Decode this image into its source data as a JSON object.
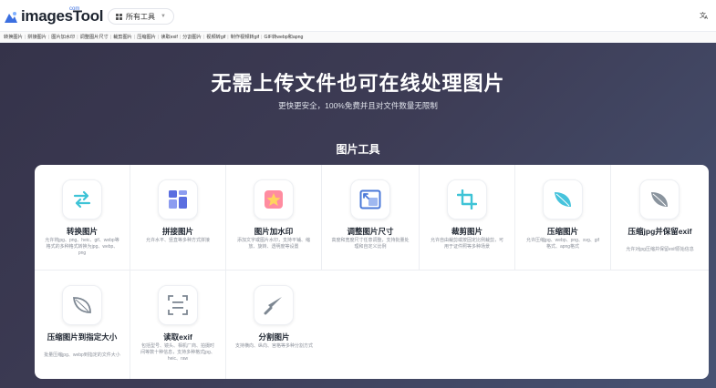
{
  "header": {
    "logo_text": "imagesTool",
    "logo_sup": "com",
    "all_tools_label": "所有工具",
    "lang_icon": "translate-icon"
  },
  "subnav": {
    "items": [
      "转换图片",
      "拼接图片",
      "图片加水印",
      "调整图片尺寸",
      "裁剪图片",
      "压缩图片",
      "读取exif",
      "分割图片",
      "视频转gif",
      "制作视频转gif",
      "GIF转webp和apng"
    ]
  },
  "hero": {
    "title": "无需上传文件也可在线处理图片",
    "subtitle": "更快更安全，100%免费并且对文件数量无限制",
    "section_title": "图片工具"
  },
  "tools": [
    {
      "name": "转换图片",
      "desc": "允许将jpg、png、heic、gif、webp等格式的多种格式转换为jpg、webp、png",
      "icon": "convert-arrows-icon"
    },
    {
      "name": "拼接图片",
      "desc": "允许水平、竖直等多种方式拼接",
      "icon": "collage-icon"
    },
    {
      "name": "图片加水印",
      "desc": "添加文字或图片水印，支持平铺、缩放、旋转、透明度等设置",
      "icon": "watermark-star-icon"
    },
    {
      "name": "调整图片尺寸",
      "desc": "高度和宽度尺寸任意调整，支持批量处理和自定义比例",
      "icon": "resize-icon"
    },
    {
      "name": "裁剪图片",
      "desc": "允许自由裁剪或按固定比例裁剪，可用于证件照等多种场景",
      "icon": "crop-icon"
    },
    {
      "name": "压缩图片",
      "desc": "允许压缩jpg、webp、png、svg、gif格式、apng格式",
      "icon": "compress-leaf-icon"
    },
    {
      "name": "压缩jpg并保留exif",
      "desc": "允许对jpg压缩并保留exif原始信息",
      "icon": "compress-exif-leaf-icon"
    },
    {
      "name": "压缩图片到指定大小",
      "desc": "批量压缩jpg、webp到指定的文件大小",
      "icon": "compress-size-leaf-icon"
    },
    {
      "name": "读取exif",
      "desc": "包括型号、镜头、相机厂商、拍摄时间等数十种信息，支持多种格式jpg、heic、raw",
      "icon": "scan-exif-icon"
    },
    {
      "name": "分割图片",
      "desc": "支持横向、纵向、宫格等多种分割方式",
      "icon": "knife-icon"
    }
  ]
}
